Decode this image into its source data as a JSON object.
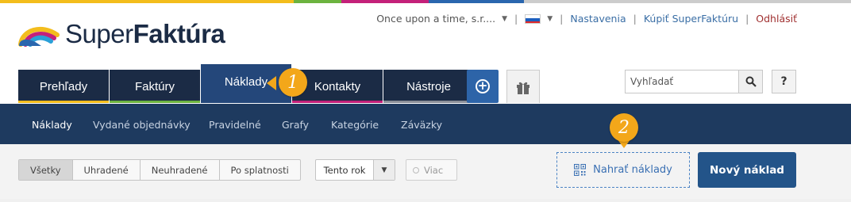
{
  "brand": {
    "name_light": "Super",
    "name_bold": "Faktúra",
    "stripe_colors": [
      "#f3bd1d",
      "#f3bd1d",
      "#6cb33f",
      "#c4217a",
      "#2a66ae",
      "#cccccc"
    ]
  },
  "toplinks": {
    "company": "Once upon a time, s.r....",
    "settings": "Nastavenia",
    "buy": "Kúpiť SuperFaktúru",
    "logout": "Odhlásiť",
    "language_flag": "slovakia-flag-icon"
  },
  "tabs": [
    {
      "label": "Prehľady",
      "color": "#f3bd1d",
      "active": false
    },
    {
      "label": "Faktúry",
      "color": "#6cb33f",
      "active": false
    },
    {
      "label": "Náklady",
      "color": "#24477a",
      "active": true
    },
    {
      "label": "Kontakty",
      "color": "#c4217a",
      "active": false
    },
    {
      "label": "Nástroje",
      "color": "#8a8f99",
      "active": false
    }
  ],
  "search": {
    "placeholder": "Vyhľadať"
  },
  "help": "?",
  "subnav": [
    {
      "label": "Náklady",
      "active": true
    },
    {
      "label": "Vydané objednávky",
      "active": false
    },
    {
      "label": "Pravidelné",
      "active": false
    },
    {
      "label": "Grafy",
      "active": false
    },
    {
      "label": "Kategórie",
      "active": false
    },
    {
      "label": "Záväzky",
      "active": false
    }
  ],
  "filters": {
    "status": [
      "Všetky",
      "Uhradené",
      "Neuhradené",
      "Po splatnosti"
    ],
    "selected": "Všetky",
    "period": "Tento rok",
    "more": "Viac"
  },
  "actions": {
    "upload": "Nahrať náklady",
    "new": "Nový náklad"
  },
  "callouts": [
    "1",
    "2"
  ],
  "colors": {
    "navy": "#1b2b45",
    "subnav": "#1e3a5f",
    "primary": "#235489",
    "accent": "#f3a71a"
  }
}
